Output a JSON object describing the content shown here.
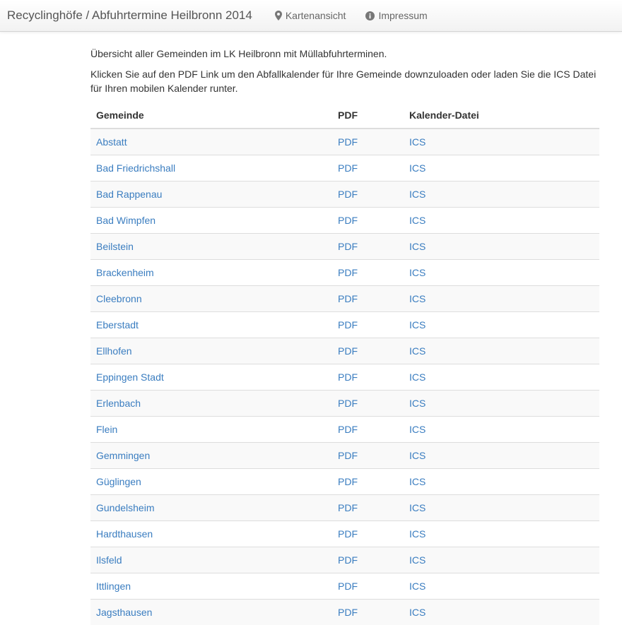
{
  "navbar": {
    "brand": "Recyclinghöfe / Abfuhrtermine Heilbronn 2014",
    "links": [
      {
        "label": "Kartenansicht",
        "icon": "map-marker-icon"
      },
      {
        "label": "Impressum",
        "icon": "info-circle-icon"
      }
    ]
  },
  "intro": {
    "line1": "Übersicht aller Gemeinden im LK Heilbronn mit Müllabfuhrterminen.",
    "line2": "Klicken Sie auf den PDF Link um den Abfallkalender für Ihre Gemeinde downzuloaden oder laden Sie die ICS Datei für Ihren mobilen Kalender runter."
  },
  "table": {
    "headers": {
      "name": "Gemeinde",
      "pdf": "PDF",
      "ics": "Kalender-Datei"
    },
    "rows": [
      {
        "name": "Abstatt",
        "pdf": "PDF",
        "ics": "ICS"
      },
      {
        "name": "Bad Friedrichshall",
        "pdf": "PDF",
        "ics": "ICS"
      },
      {
        "name": "Bad Rappenau",
        "pdf": "PDF",
        "ics": "ICS"
      },
      {
        "name": "Bad Wimpfen",
        "pdf": "PDF",
        "ics": "ICS"
      },
      {
        "name": "Beilstein",
        "pdf": "PDF",
        "ics": "ICS"
      },
      {
        "name": "Brackenheim",
        "pdf": "PDF",
        "ics": "ICS"
      },
      {
        "name": "Cleebronn",
        "pdf": "PDF",
        "ics": "ICS"
      },
      {
        "name": "Eberstadt",
        "pdf": "PDF",
        "ics": "ICS"
      },
      {
        "name": "Ellhofen",
        "pdf": "PDF",
        "ics": "ICS"
      },
      {
        "name": "Eppingen Stadt",
        "pdf": "PDF",
        "ics": "ICS"
      },
      {
        "name": "Erlenbach",
        "pdf": "PDF",
        "ics": "ICS"
      },
      {
        "name": "Flein",
        "pdf": "PDF",
        "ics": "ICS"
      },
      {
        "name": "Gemmingen",
        "pdf": "PDF",
        "ics": "ICS"
      },
      {
        "name": "Güglingen",
        "pdf": "PDF",
        "ics": "ICS"
      },
      {
        "name": "Gundelsheim",
        "pdf": "PDF",
        "ics": "ICS"
      },
      {
        "name": "Hardthausen",
        "pdf": "PDF",
        "ics": "ICS"
      },
      {
        "name": "Ilsfeld",
        "pdf": "PDF",
        "ics": "ICS"
      },
      {
        "name": "Ittlingen",
        "pdf": "PDF",
        "ics": "ICS"
      },
      {
        "name": "Jagsthausen",
        "pdf": "PDF",
        "ics": "ICS"
      }
    ]
  },
  "colors": {
    "link": "#3a7dc0",
    "text": "#333333",
    "stripe": "#f9f9f9"
  }
}
